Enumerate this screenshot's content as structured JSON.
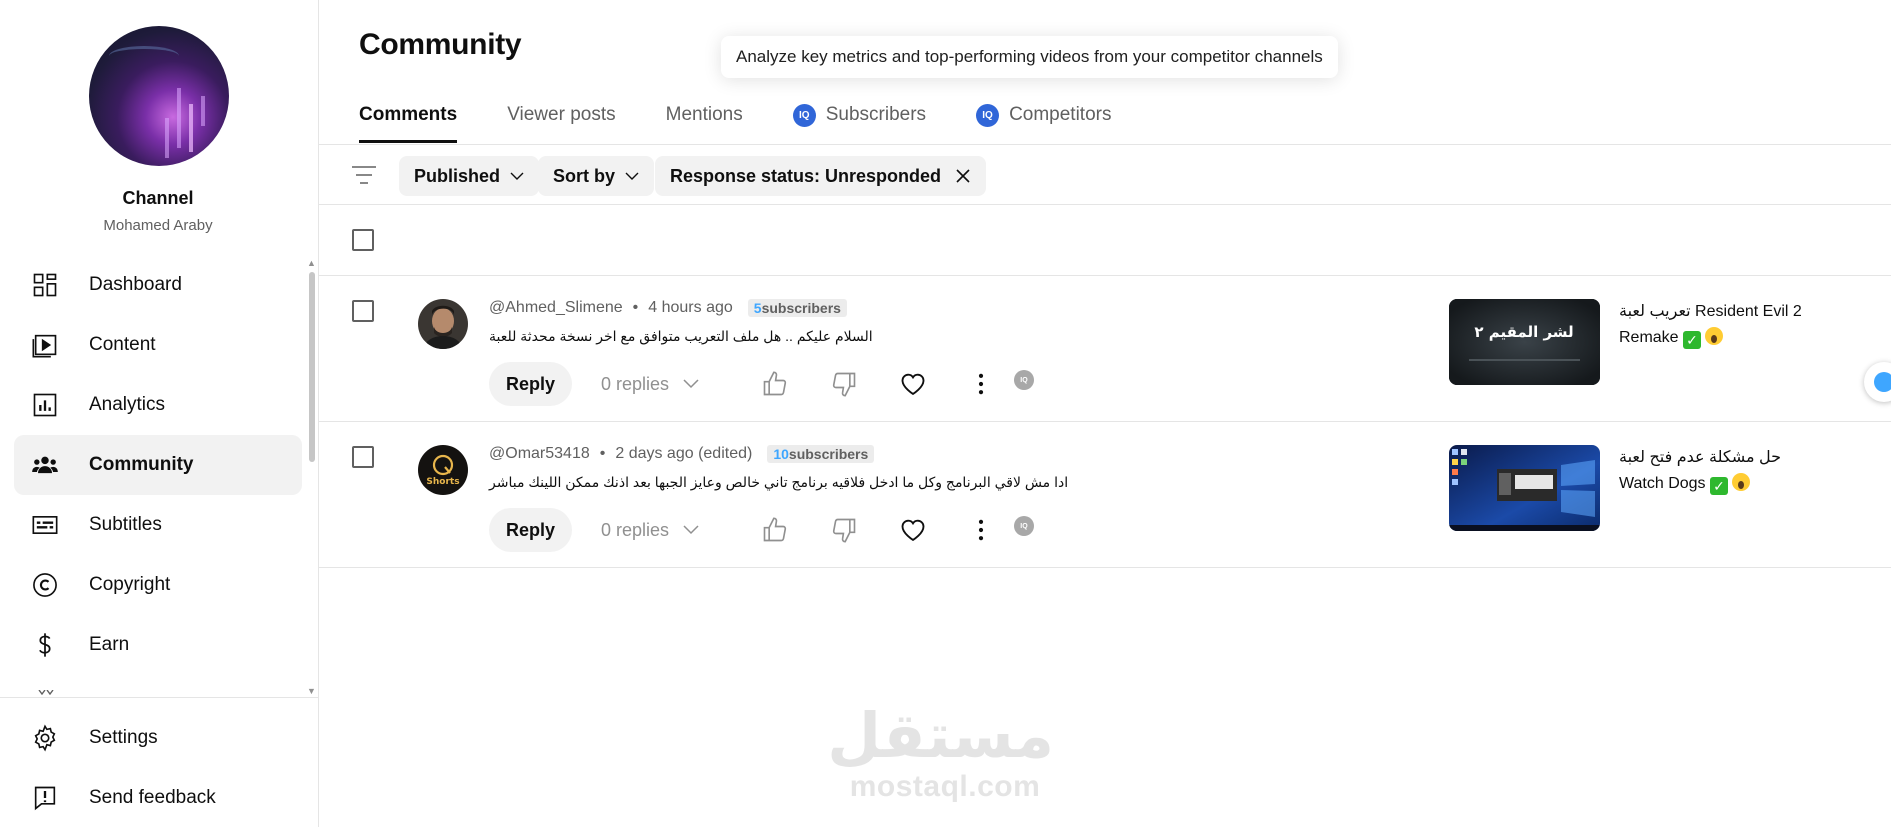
{
  "sidebar": {
    "channel_label": "Channel",
    "channel_handle": "Mohamed Araby",
    "items": [
      {
        "label": "Dashboard",
        "icon": "dashboard-icon"
      },
      {
        "label": "Content",
        "icon": "content-icon"
      },
      {
        "label": "Analytics",
        "icon": "analytics-icon"
      },
      {
        "label": "Community",
        "icon": "community-icon",
        "active": true
      },
      {
        "label": "Subtitles",
        "icon": "subtitles-icon"
      },
      {
        "label": "Copyright",
        "icon": "copyright-icon"
      },
      {
        "label": "Earn",
        "icon": "earn-icon"
      }
    ],
    "bottom_items": [
      {
        "label": "Settings",
        "icon": "gear-icon"
      },
      {
        "label": "Send feedback",
        "icon": "feedback-icon"
      }
    ]
  },
  "header": {
    "title": "Community",
    "tooltip": "Analyze key metrics and top-performing videos from your competitor channels"
  },
  "tabs": [
    {
      "label": "Comments",
      "active": true
    },
    {
      "label": "Viewer posts"
    },
    {
      "label": "Mentions"
    },
    {
      "label": "Subscribers",
      "badge": "IQ"
    },
    {
      "label": "Competitors",
      "badge": "IQ"
    }
  ],
  "filters": {
    "published": "Published",
    "sort_by": "Sort by",
    "response_status": "Response status: Unresponded"
  },
  "comments": [
    {
      "author": "@Ahmed_Slimene",
      "time": "4 hours ago",
      "subscribers_count": "5",
      "subscribers_label": "subscribers",
      "text": "السلام عليكم .. هل ملف التعريب متوافق مع اخر نسخة محدثة للعبة",
      "reply_label": "Reply",
      "replies_label": "0 replies",
      "video_title": "تعريب لعبة  Resident Evil 2 Remake",
      "thumb_text": "لشر المقيم ٢"
    },
    {
      "author": "@Omar53418",
      "time": "2 days ago (edited)",
      "subscribers_count": "10",
      "subscribers_label": "subscribers",
      "text": "ادا مش لاقي البرنامج وكل ما ادخل فلاقيه برنامج تاني خالص وعايز الجبها بعد اذنك ممكن اللينك مباشر",
      "reply_label": "Reply",
      "replies_label": "0 replies",
      "video_title": "حل مشكلة عدم فتح لعبة Watch Dogs",
      "avatar_text": "Shorts"
    }
  ],
  "watermark": {
    "arabic": "مستقل",
    "latin": "mostaql.com"
  },
  "colors": {
    "accent_blue": "#3ea6ff",
    "iq_badge": "#3066d8",
    "active_nav_bg": "#f2f2f2"
  }
}
